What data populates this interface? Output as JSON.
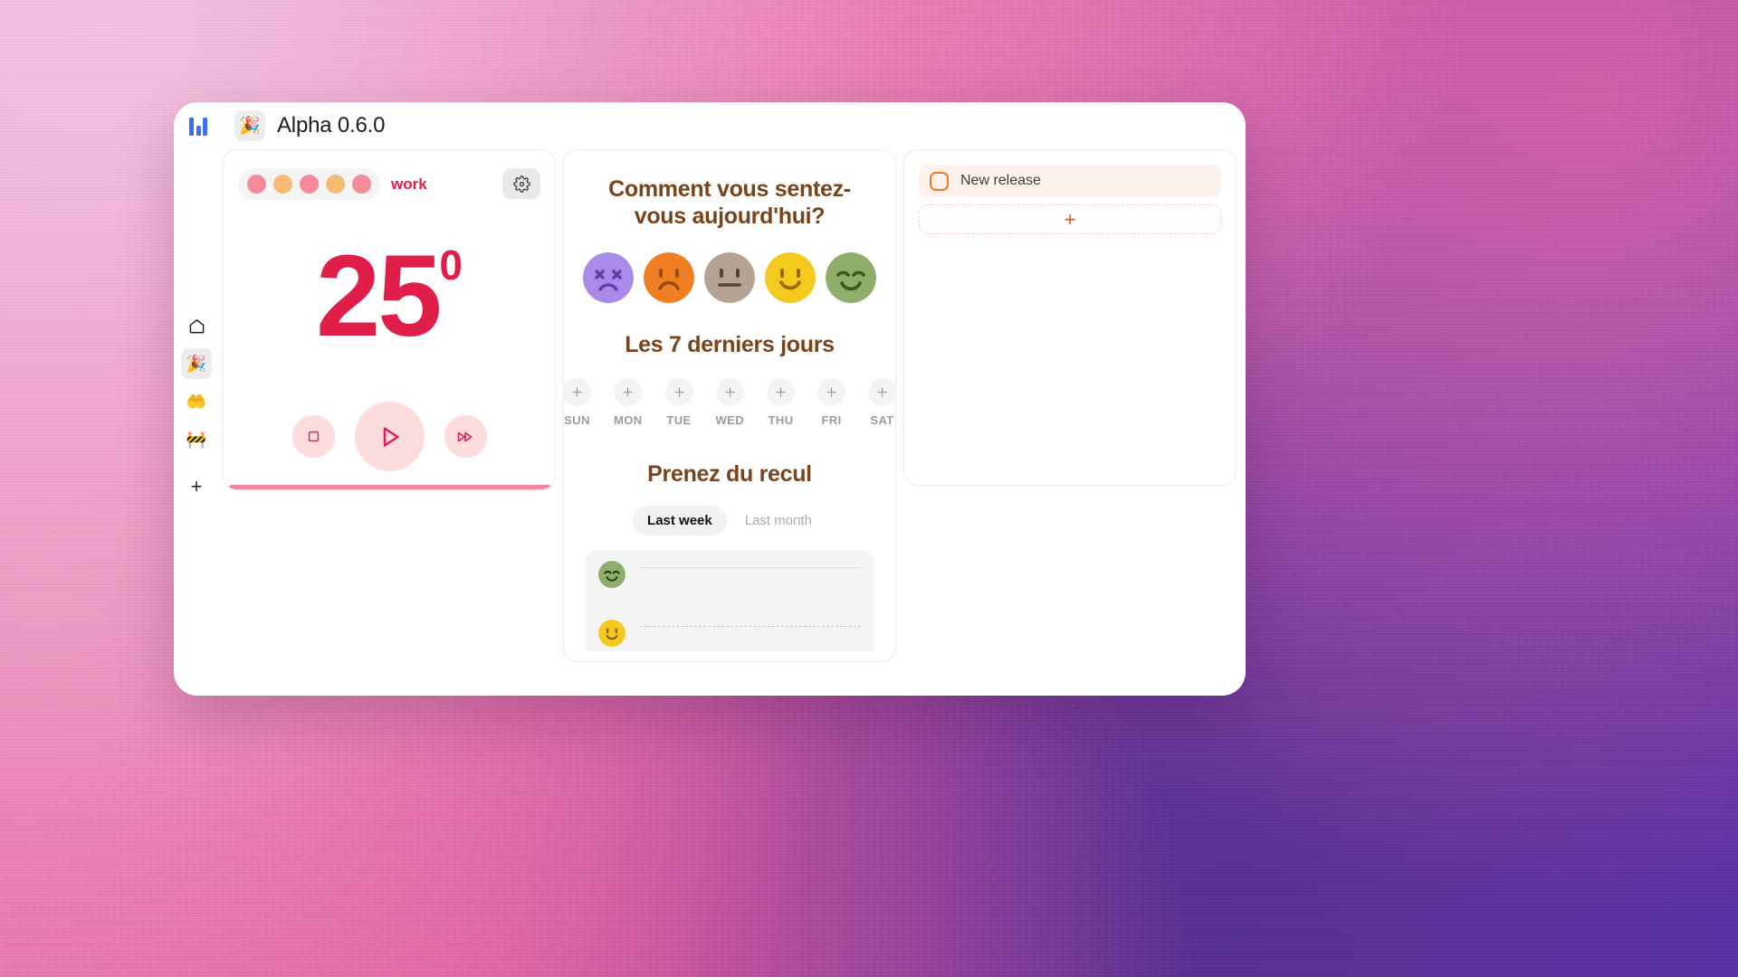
{
  "window": {
    "title": "Alpha 0.6.0",
    "app_emoji": "🎉",
    "logo_icon": "bar-logo-icon"
  },
  "sidebar": {
    "items": [
      {
        "icon": "home-icon",
        "glyph": "⌂",
        "active": false
      },
      {
        "icon": "party-popper-icon",
        "glyph": "🎉",
        "active": true
      },
      {
        "icon": "open-hands-icon",
        "glyph": "🤲",
        "active": false
      },
      {
        "icon": "construction-icon",
        "glyph": "🚧",
        "active": false
      }
    ],
    "add_label": "+"
  },
  "timer": {
    "session_label": "work",
    "dots": [
      "pink",
      "orange",
      "pink",
      "orange",
      "pink"
    ],
    "value": "25",
    "superscript": "0",
    "settings_icon": "gear-icon",
    "controls": [
      {
        "name": "stop-button",
        "icon": "stop-icon"
      },
      {
        "name": "play-button",
        "icon": "play-icon"
      },
      {
        "name": "skip-button",
        "icon": "fast-forward-icon"
      }
    ],
    "progress_percent": 100,
    "accent_color": "#e01e4a"
  },
  "mood": {
    "title": "Comment vous sentez-vous aujourd'hui?",
    "faces": [
      {
        "name": "mood-dead",
        "color": "#a98ae8",
        "eyes": "x",
        "mouth": "frown"
      },
      {
        "name": "mood-sad",
        "color": "#ef7f22",
        "eyes": "dot",
        "mouth": "frown"
      },
      {
        "name": "mood-neutral",
        "color": "#b6a195",
        "eyes": "dot",
        "mouth": "flat"
      },
      {
        "name": "mood-happy",
        "color": "#f4c81c",
        "eyes": "dot",
        "mouth": "smile"
      },
      {
        "name": "mood-great",
        "color": "#8fad6b",
        "eyes": "arc",
        "mouth": "smile"
      }
    ],
    "week_title": "Les 7 derniers jours",
    "days": [
      "SUN",
      "MON",
      "TUE",
      "WED",
      "THU",
      "FRI",
      "SAT"
    ],
    "day_add_icon": "plus-icon",
    "recul_title": "Prenez du recul",
    "tabs": [
      {
        "label": "Last week",
        "active": true
      },
      {
        "label": "Last month",
        "active": false
      }
    ],
    "entries": [
      {
        "face_color": "#8fad6b",
        "face_type": "great",
        "divider": "solid"
      },
      {
        "face_color": "#f4c81c",
        "face_type": "happy",
        "divider": "dashed"
      }
    ],
    "heading_color": "#7a431a"
  },
  "tasks": {
    "items": [
      {
        "label": "New release",
        "checked": false,
        "accent": "#ef7a22"
      }
    ],
    "add_label": "+"
  },
  "dock": {
    "buttons": [
      {
        "name": "add-button",
        "icon": "plus-icon",
        "dashed": true
      },
      {
        "name": "add-person-button",
        "icon": "person-add-icon",
        "dashed": false
      },
      {
        "name": "comment-button",
        "icon": "chat-bubble-icon",
        "dashed": false
      },
      {
        "name": "settings-button",
        "icon": "gear-icon",
        "dashed": false
      },
      {
        "name": "filters-button",
        "icon": "sliders-icon",
        "dashed": false
      },
      {
        "name": "search-button",
        "icon": "search-icon",
        "dashed": false
      }
    ]
  }
}
